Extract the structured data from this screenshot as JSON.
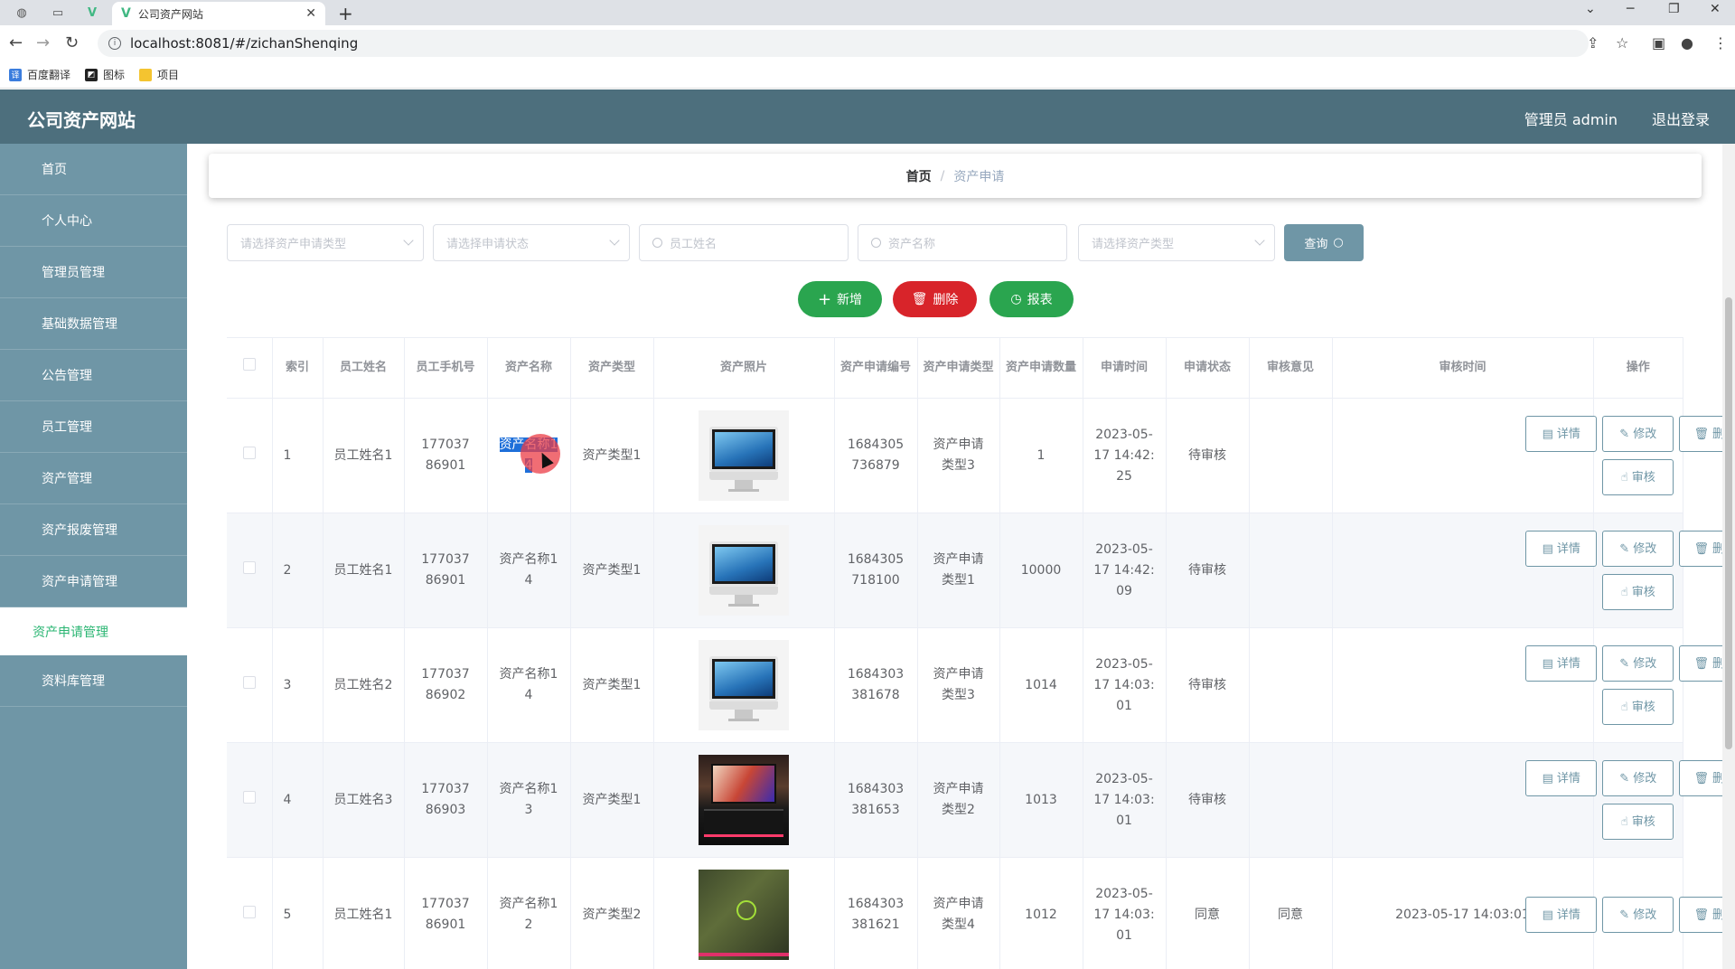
{
  "browser": {
    "tab_title": "公司资产网站",
    "url": "localhost:8081/#/zichanShenqing",
    "bookmarks": [
      "百度翻译",
      "图标",
      "项目"
    ]
  },
  "header": {
    "title": "公司资产网站",
    "user": "管理员 admin",
    "logout": "退出登录"
  },
  "sidebar": {
    "items": [
      "首页",
      "个人中心",
      "管理员管理",
      "基础数据管理",
      "公告管理",
      "员工管理",
      "资产管理",
      "资产报废管理",
      "资产申请管理"
    ],
    "active_sub": "资产申请管理",
    "after_items": [
      "资料库管理"
    ]
  },
  "breadcrumb": {
    "home": "首页",
    "separator": "/",
    "current": "资产申请"
  },
  "filters": {
    "apply_type_placeholder": "请选择资产申请类型",
    "status_placeholder": "请选择申请状态",
    "employee_placeholder": "员工姓名",
    "asset_name_placeholder": "资产名称",
    "asset_type_placeholder": "请选择资产类型",
    "query_label": "查询"
  },
  "actions": {
    "add": "新增",
    "delete": "删除",
    "report": "报表"
  },
  "colors": {
    "header": "#4d6f7d",
    "sidebar": "#6f96a6",
    "green": "#2aa54f",
    "red": "#d8242a",
    "active_text": "#2bb673"
  },
  "table": {
    "headers": [
      "索引",
      "员工姓名",
      "员工手机号",
      "资产名称",
      "资产类型",
      "资产照片",
      "资产申请编号",
      "资产申请类型",
      "资产申请数量",
      "申请时间",
      "申请状态",
      "审核意见",
      "审核时间",
      "操作"
    ],
    "op_labels": {
      "detail": "详情",
      "edit": "修改",
      "delete": "删除",
      "review": "审核"
    },
    "rows": [
      {
        "index": "1",
        "name": "员工姓名1",
        "phone": "17703786901",
        "asset": "资产名称14",
        "type": "资产类型1",
        "photo": "imac",
        "code": "1684305736879",
        "apply_type": "资产申请类型3",
        "qty": "1",
        "time": "2023-05-17 14:42:25",
        "status": "待审核",
        "opinion": "",
        "review_time": ""
      },
      {
        "index": "2",
        "name": "员工姓名1",
        "phone": "17703786901",
        "asset": "资产名称14",
        "type": "资产类型1",
        "photo": "imac",
        "code": "1684305718100",
        "apply_type": "资产申请类型1",
        "qty": "10000",
        "time": "2023-05-17 14:42:09",
        "status": "待审核",
        "opinion": "",
        "review_time": ""
      },
      {
        "index": "3",
        "name": "员工姓名2",
        "phone": "17703786902",
        "asset": "资产名称14",
        "type": "资产类型1",
        "photo": "imac",
        "code": "1684303381678",
        "apply_type": "资产申请类型3",
        "qty": "1014",
        "time": "2023-05-17 14:03:01",
        "status": "待审核",
        "opinion": "",
        "review_time": ""
      },
      {
        "index": "4",
        "name": "员工姓名3",
        "phone": "17703786903",
        "asset": "资产名称13",
        "type": "资产类型1",
        "photo": "laptop",
        "code": "1684303381653",
        "apply_type": "资产申请类型2",
        "qty": "1013",
        "time": "2023-05-17 14:03:01",
        "status": "待审核",
        "opinion": "",
        "review_time": ""
      },
      {
        "index": "5",
        "name": "员工姓名1",
        "phone": "17703786901",
        "asset": "资产名称12",
        "type": "资产类型2",
        "photo": "green-laptop",
        "code": "1684303381621",
        "apply_type": "资产申请类型4",
        "qty": "1012",
        "time": "2023-05-17 14:03:01",
        "status": "同意",
        "opinion": "同意",
        "review_time": "2023-05-17 14:03:01"
      }
    ]
  }
}
